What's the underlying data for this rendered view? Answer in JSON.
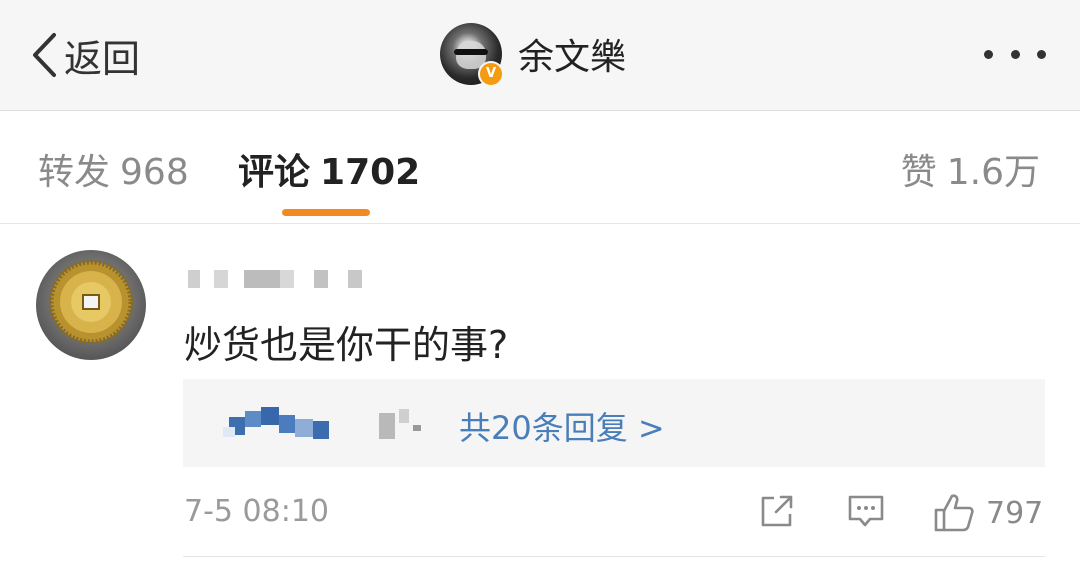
{
  "nav": {
    "back_label": "返回",
    "title": "余文樂",
    "verified_badge": "V",
    "icons": {
      "back": "chevron-left-icon",
      "more": "more-dots-icon"
    }
  },
  "tabs": {
    "repost": {
      "label": "转发",
      "count": "968"
    },
    "comment": {
      "label": "评论",
      "count": "1702",
      "active": true
    },
    "like": {
      "label": "赞",
      "count": "1.6万"
    },
    "accent_color": "#f18b1f"
  },
  "comment": {
    "text": "炒货也是你干的事?",
    "reply_link": "共20条回复 >",
    "timestamp": "7-5 08:10",
    "like_count": "797",
    "icons": {
      "share": "share-icon",
      "reply": "comment-icon",
      "like": "thumbs-up-icon"
    }
  },
  "colors": {
    "link": "#4a7eb8",
    "muted_text": "#9a9a9a",
    "badge": "#f39c12"
  }
}
